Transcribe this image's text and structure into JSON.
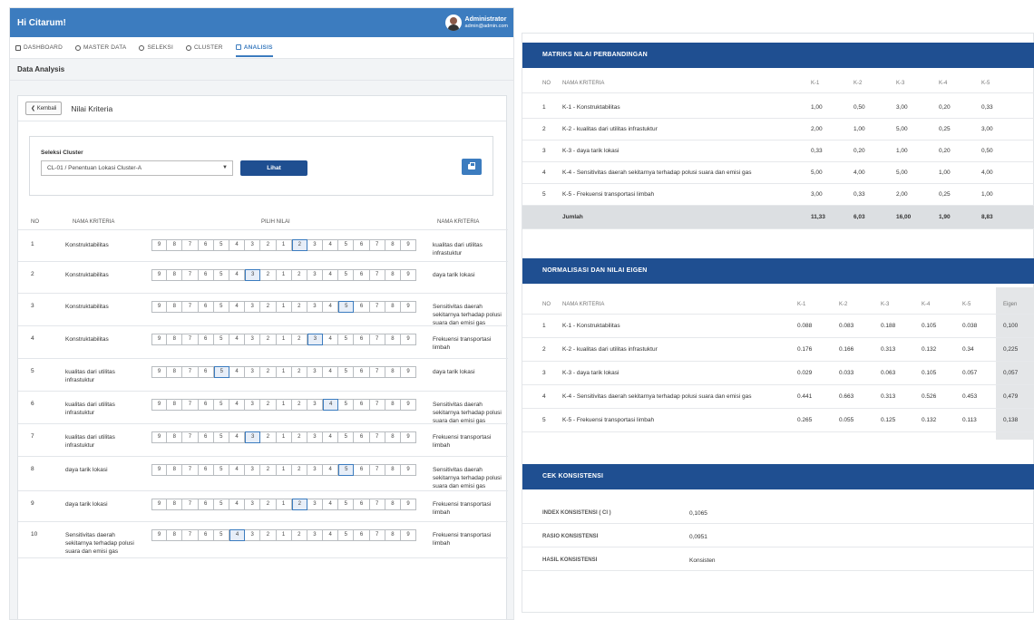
{
  "header": {
    "greeting": "Hi Citarum!",
    "user_name": "Administrator",
    "user_email": "admin@admin.com"
  },
  "nav": [
    {
      "label": "DASHBOARD",
      "icon": "home-icon"
    },
    {
      "label": "MASTER DATA",
      "icon": "database-icon"
    },
    {
      "label": "SELEKSI",
      "icon": "shield-icon"
    },
    {
      "label": "CLUSTER",
      "icon": "shield-icon"
    },
    {
      "label": "ANALISIS",
      "icon": "document-icon",
      "active": true
    }
  ],
  "section_title": "Data Analysis",
  "card": {
    "back_label": "Kembali",
    "title": "Nilai Kriteria"
  },
  "filter": {
    "label": "Seleksi Cluster",
    "selected": "CL-01 / Penentuan Lokasi Cluster-A",
    "button": "Lihat"
  },
  "criteria_table": {
    "headers": {
      "no": "NO",
      "a": "NAMA KRITERIA",
      "pilih": "PILIH NILAI",
      "b": "NAMA KRITERIA"
    },
    "scale": [
      "9",
      "8",
      "7",
      "6",
      "5",
      "4",
      "3",
      "2",
      "1",
      "2",
      "3",
      "4",
      "5",
      "6",
      "7",
      "8",
      "9"
    ],
    "rows": [
      {
        "no": "1",
        "a": "Konstruktabilitas",
        "b": "kualitas dari utilitas infrastuktur",
        "sel": 9
      },
      {
        "no": "2",
        "a": "Konstruktabilitas",
        "b": "daya tarik lokasi",
        "sel": 6
      },
      {
        "no": "3",
        "a": "Konstruktabilitas",
        "b": "Sensitivitas daerah sekitarnya terhadap polusi suara dan emisi gas",
        "sel": 12
      },
      {
        "no": "4",
        "a": "Konstruktabilitas",
        "b": "Frekuensi transportasi limbah",
        "sel": 10
      },
      {
        "no": "5",
        "a": "kualitas dari utilitas infrastuktur",
        "b": "daya tarik lokasi",
        "sel": 4
      },
      {
        "no": "6",
        "a": "kualitas dari utilitas infrastuktur",
        "b": "Sensitivitas daerah sekitarnya terhadap polusi suara dan emisi gas",
        "sel": 11
      },
      {
        "no": "7",
        "a": "kualitas dari utilitas infrastuktur",
        "b": "Frekuensi transportasi limbah",
        "sel": 6
      },
      {
        "no": "8",
        "a": "daya tarik lokasi",
        "b": "Sensitivitas daerah sekitarnya terhadap polusi suara dan emisi gas",
        "sel": 12
      },
      {
        "no": "9",
        "a": "daya tarik lokasi",
        "b": "Frekuensi transportasi limbah",
        "sel": 9
      },
      {
        "no": "10",
        "a": "Sensitivitas daerah sekitarnya terhadap polusi suara dan emisi gas",
        "b": "Frekuensi transportasi limbah",
        "sel": 5
      }
    ]
  },
  "matriks": {
    "title": "MATRIKS NILAI PERBANDINGAN",
    "headers": [
      "NO",
      "NAMA KRITERIA",
      "K-1",
      "K-2",
      "K-3",
      "K-4",
      "K-5"
    ],
    "rows": [
      [
        "1",
        "K-1 - Konstruktabilitas",
        "1,00",
        "0,50",
        "3,00",
        "0,20",
        "0,33"
      ],
      [
        "2",
        "K-2 - kualitas dari utilitas infrastuktur",
        "2,00",
        "1,00",
        "5,00",
        "0,25",
        "3,00"
      ],
      [
        "3",
        "K-3 - daya tarik lokasi",
        "0,33",
        "0,20",
        "1,00",
        "0,20",
        "0,50"
      ],
      [
        "4",
        "K-4 - Sensitivitas daerah sekitarnya terhadap polusi suara dan emisi gas",
        "5,00",
        "4,00",
        "5,00",
        "1,00",
        "4,00"
      ],
      [
        "5",
        "K-5 - Frekuensi transportasi limbah",
        "3,00",
        "0,33",
        "2,00",
        "0,25",
        "1,00"
      ]
    ],
    "sum": [
      "",
      "Jumlah",
      "11,33",
      "6,03",
      "16,00",
      "1,90",
      "8,83"
    ]
  },
  "normalisasi": {
    "title": "NORMALISASI DAN NILAI EIGEN",
    "headers": [
      "NO",
      "NAMA KRITERIA",
      "K-1",
      "K-2",
      "K-3",
      "K-4",
      "K-5",
      "Eigen"
    ],
    "rows": [
      [
        "1",
        "K-1 - Konstruktabilitas",
        "0.088",
        "0.083",
        "0.188",
        "0.105",
        "0.038",
        "0,100"
      ],
      [
        "2",
        "K-2 - kualitas dari utilitas infrastuktur",
        "0.176",
        "0.166",
        "0.313",
        "0.132",
        "0.34",
        "0,225"
      ],
      [
        "3",
        "K-3 - daya tarik lokasi",
        "0.029",
        "0.033",
        "0.063",
        "0.105",
        "0.057",
        "0,057"
      ],
      [
        "4",
        "K-4 - Sensitivitas daerah sekitarnya terhadap polusi suara dan emisi gas",
        "0.441",
        "0.663",
        "0.313",
        "0.526",
        "0.453",
        "0,479"
      ],
      [
        "5",
        "K-5 - Frekuensi transportasi limbah",
        "0.265",
        "0.055",
        "0.125",
        "0.132",
        "0.113",
        "0,138"
      ]
    ]
  },
  "konsistensi": {
    "title": "CEK KONSISTENSI",
    "items": [
      {
        "label": "INDEX KONSISTENSI ( CI )",
        "value": "0,1065"
      },
      {
        "label": "RASIO KONSISTENSI",
        "value": "0,0951"
      },
      {
        "label": "HASIL KONSISTENSI",
        "value": "Konsisten"
      }
    ]
  },
  "colors": {
    "primary": "#3c7cbf",
    "header_dark": "#1f4f91",
    "sum_bg": "#dcdfe2"
  }
}
